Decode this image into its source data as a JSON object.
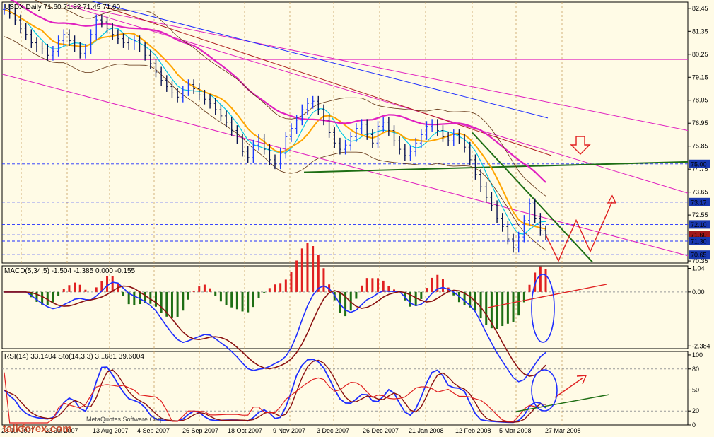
{
  "chart_data": [
    {
      "type": "line",
      "panel": "price",
      "header": "USDX,Daily  71.60 71.82 71.45 71.60",
      "ylim": [
        70.25,
        82.75
      ],
      "yticks": [
        82.45,
        81.35,
        80.25,
        79.15,
        78.05,
        76.95,
        75.85,
        74.75,
        73.65,
        72.55,
        71.45,
        70.35
      ],
      "price_boxes": [
        {
          "label": "75.00",
          "value": 75.0
        },
        {
          "label": "73.17",
          "value": 73.17
        },
        {
          "label": "72.10",
          "value": 72.1
        },
        {
          "label": "71.60",
          "value": 71.6
        },
        {
          "label": "71.30",
          "value": 71.3
        },
        {
          "label": "70.65",
          "value": 70.65
        }
      ],
      "close_series": [
        82.4,
        82.2,
        81.9,
        81.5,
        81.2,
        80.8,
        80.6,
        80.5,
        80.2,
        80.4,
        80.9,
        81.2,
        80.9,
        80.6,
        80.3,
        80.5,
        81.2,
        81.9,
        81.8,
        81.5,
        81.2,
        81.0,
        80.8,
        80.7,
        80.9,
        80.6,
        80.2,
        79.8,
        79.4,
        79.0,
        78.7,
        78.4,
        78.2,
        78.5,
        78.8,
        78.6,
        78.3,
        78.1,
        77.9,
        77.6,
        77.3,
        77.0,
        76.6,
        76.2,
        75.6,
        75.3,
        75.9,
        76.2,
        75.7,
        75.2,
        75.0,
        75.5,
        76.3,
        76.7,
        77.1,
        77.6,
        77.9,
        78.0,
        77.6,
        77.1,
        76.5,
        76.0,
        75.7,
        75.9,
        76.3,
        76.7,
        76.9,
        76.4,
        76.0,
        76.8,
        77.0,
        76.6,
        76.1,
        75.7,
        75.4,
        75.6,
        76.0,
        76.4,
        76.8,
        76.9,
        76.6,
        76.3,
        76.1,
        76.4,
        76.2,
        75.8,
        75.2,
        74.5,
        73.9,
        73.4,
        73.0,
        72.4,
        72.0,
        71.4,
        71.0,
        71.5,
        72.3,
        73.1,
        72.4,
        71.8,
        71.6
      ]
    },
    {
      "type": "line",
      "panel": "macd",
      "header": "MACD(5,34,5) -1.504 -1.385 0.000 -0.155",
      "ylim": [
        -2.5,
        1.15
      ],
      "yticks": [
        {
          "label": "1.04",
          "value": 1.04
        },
        {
          "label": "0.00",
          "value": 0.0
        },
        {
          "label": "-2.384",
          "value": -2.384
        }
      ]
    },
    {
      "type": "line",
      "panel": "rsi",
      "header": "RSI(14) 33.1404 Sto(14,3,3) 3...681 39.6004",
      "ylim": [
        0,
        105
      ],
      "yticks": [
        {
          "label": "100",
          "value": 100
        },
        {
          "label": "80",
          "value": 80
        },
        {
          "label": "50",
          "value": 50
        },
        {
          "label": "20",
          "value": 20
        },
        {
          "label": "0",
          "value": 0
        }
      ]
    }
  ],
  "x_axis": {
    "labels": [
      "13 Aug 2007",
      "4 Sep 2007",
      "26 Sep 2007",
      "18 Oct 2007",
      "9 Nov 2007",
      "3 Dec 2007",
      "26 Dec 2007",
      "21 Jan 2008",
      "12 Feb 2008",
      "5 Mar 2008",
      "27 Mar 2008"
    ],
    "left_labels": [
      "23 Jul 2007",
      "23 Jul 2007"
    ]
  },
  "watermark": {
    "site": "talkforex.com",
    "copyright": "MetaQuotes Software Corp."
  },
  "colors": {
    "background": "#fffbe6",
    "grid": "#c8a060",
    "bull": "#1e3cff",
    "bear": "#0a1450",
    "ma_orange": "#ffa500",
    "ma_magenta": "#e020c0",
    "ma_blue": "#1e2dff",
    "trend_green": "#1e6e14",
    "trend_red": "#e02020",
    "histo_up": "#e02020",
    "histo_down": "#1e6e14"
  }
}
